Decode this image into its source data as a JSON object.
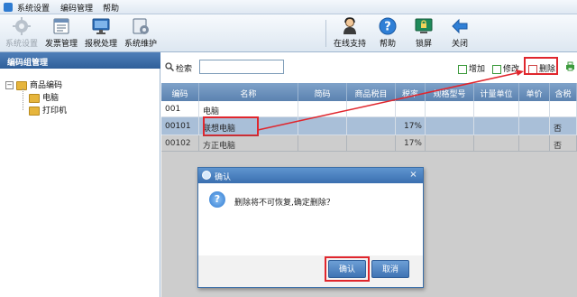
{
  "menubar": {
    "items": [
      "系统设置",
      "编码管理",
      "帮助"
    ]
  },
  "toolbar": {
    "left_buttons": [
      {
        "label": "系统设置",
        "icon": "gear-icon",
        "disabled": true
      },
      {
        "label": "发票管理",
        "icon": "invoice-icon",
        "disabled": false
      },
      {
        "label": "报税处理",
        "icon": "monitor-icon",
        "disabled": false
      },
      {
        "label": "系统维护",
        "icon": "maintenance-icon",
        "disabled": false
      }
    ],
    "right_buttons": [
      {
        "label": "在线支持",
        "icon": "support-person-icon"
      },
      {
        "label": "帮助",
        "icon": "help-icon"
      },
      {
        "label": "锁屏",
        "icon": "lock-screen-icon"
      },
      {
        "label": "关闭",
        "icon": "close-arrow-icon"
      }
    ]
  },
  "left_panel": {
    "title": "编码组管理",
    "tree": {
      "root": "商品编码",
      "children": [
        "电脑",
        "打印机"
      ]
    }
  },
  "search": {
    "label": "检索",
    "value": ""
  },
  "actions": {
    "add": "增加",
    "edit": "修改",
    "delete": "删除"
  },
  "table": {
    "columns": [
      "编码",
      "名称",
      "简码",
      "商品税目",
      "税率",
      "规格型号",
      "计量单位",
      "单价",
      "含税"
    ],
    "rows": [
      {
        "code": "001",
        "name": "电脑",
        "short": "",
        "tax_item": "",
        "rate": "",
        "spec": "",
        "unit": "",
        "price": "",
        "incl": "",
        "selected": false
      },
      {
        "code": "00101",
        "name": "联想电脑",
        "short": "",
        "tax_item": "",
        "rate": "17%",
        "spec": "",
        "unit": "",
        "price": "",
        "incl": "否",
        "selected": true
      },
      {
        "code": "00102",
        "name": "方正电脑",
        "short": "",
        "tax_item": "",
        "rate": "17%",
        "spec": "",
        "unit": "",
        "price": "",
        "incl": "否",
        "selected": false
      }
    ]
  },
  "dialog": {
    "title": "确认",
    "message": "删除将不可恢复,确定删除？",
    "ok": "确认",
    "cancel": "取消",
    "close_glyph": "×",
    "question_glyph": "?"
  },
  "colors": {
    "highlight_red": "#e0262d",
    "header_blue": "#5b82b0",
    "selection": "#a9bfd8"
  }
}
